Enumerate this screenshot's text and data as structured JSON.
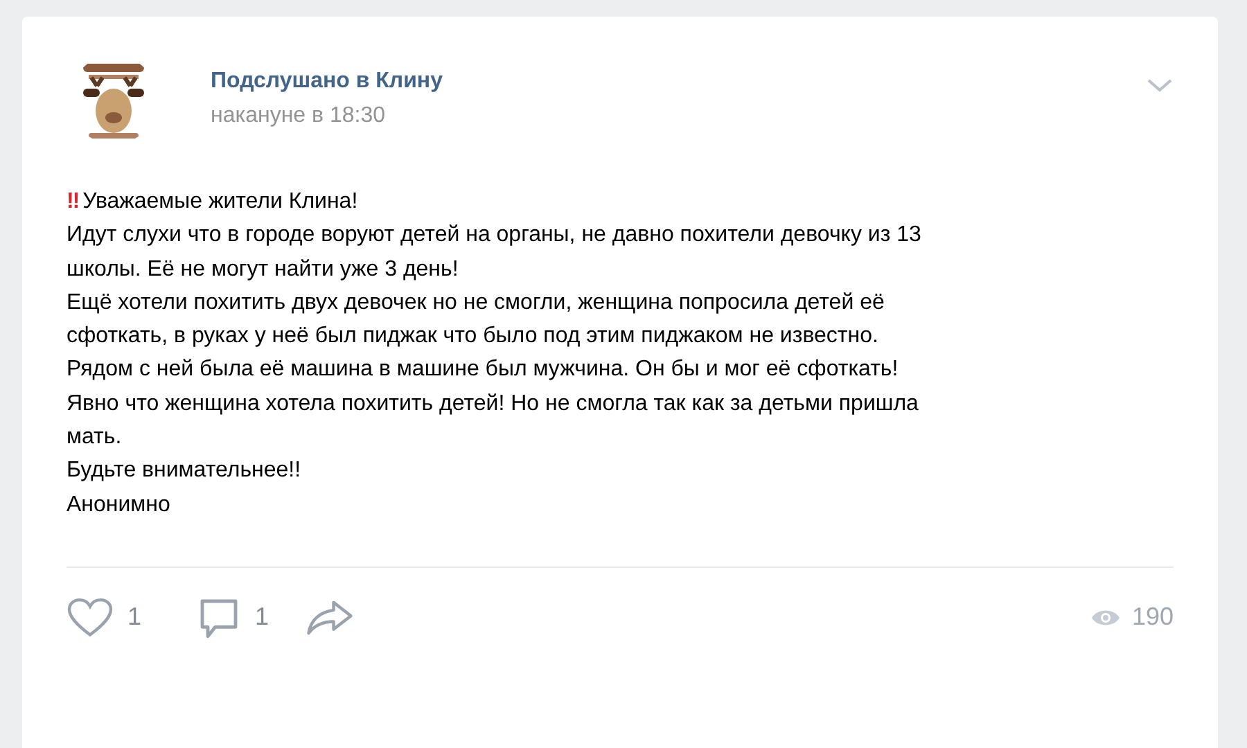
{
  "post": {
    "author": "Подслушано в Клину",
    "time": "накануне в 18:30",
    "lines": [
      {
        "icon": "‼",
        "text": "Уважаемые жители Клина!"
      },
      {
        "text": "Идут слухи что в городе воруют детей на органы, не давно похители девочку из 13"
      },
      {
        "text": "школы. Её не могут найти уже 3 день!"
      },
      {
        "text": "Ещё хотели похитить двух девочек но не смогли, женщина попросила детей её"
      },
      {
        "text": "сфоткать, в руках у неё был пиджак что было под этим пиджаком не известно."
      },
      {
        "text": "Рядом с ней была её машина в машине был мужчина. Он бы и мог её сфоткать!"
      },
      {
        "text": "Явно что женщина хотела похитить детей! Но не смогла так как за детьми пришла"
      },
      {
        "text": "мать."
      },
      {
        "text": "Будьте внимательнее!!"
      },
      {
        "text": "Анонимно"
      }
    ],
    "likes": "1",
    "comments": "1",
    "views": "190"
  }
}
